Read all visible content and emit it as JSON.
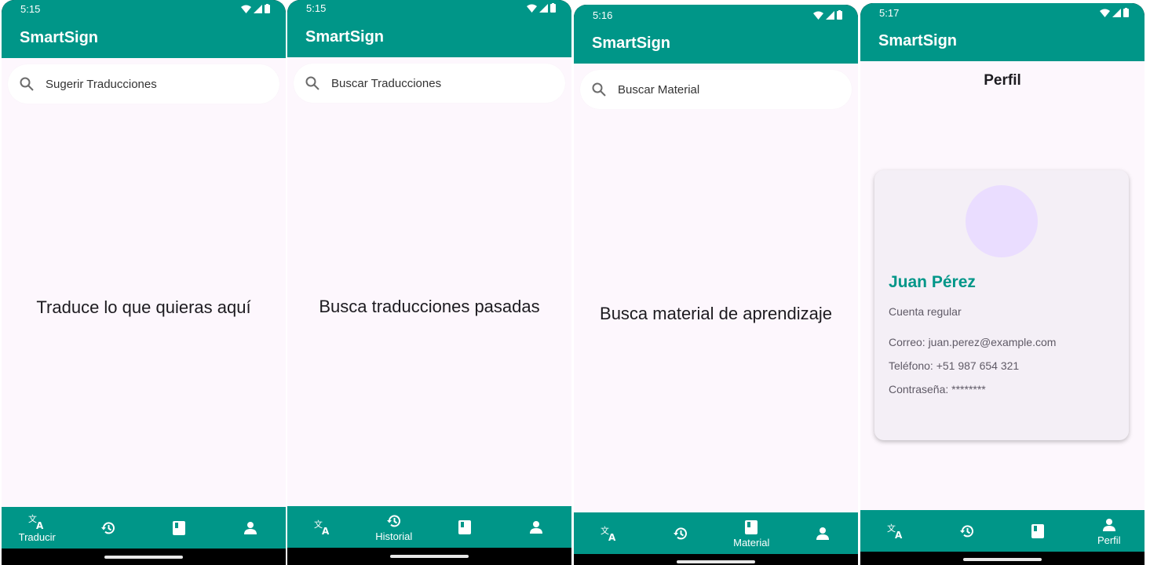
{
  "app_title": "SmartSign",
  "nav": {
    "translate_label": "Traducir",
    "history_label": "Historial",
    "material_label": "Material",
    "profile_label": "Perfil"
  },
  "screens": [
    {
      "time": "5:15",
      "search_placeholder": "Sugerir Traducciones",
      "body_text": "Traduce lo que quieras aquí",
      "active_tab": "translate"
    },
    {
      "time": "5:15",
      "search_placeholder": "Buscar Traducciones",
      "body_text": "Busca traducciones pasadas",
      "active_tab": "history"
    },
    {
      "time": "5:16",
      "search_placeholder": "Buscar Material",
      "body_text": "Busca material de aprendizaje",
      "active_tab": "material"
    },
    {
      "time": "5:17",
      "title": "Perfil",
      "active_tab": "profile",
      "profile": {
        "name": "Juan Pérez",
        "account_type": "Cuenta regular",
        "email": "Correo: juan.perez@example.com",
        "phone": "Teléfono: +51 987 654 321",
        "password": "Contraseña: ********"
      }
    }
  ],
  "colors": {
    "primary": "#009688",
    "background": "#fdf7fd",
    "avatar": "#eaddff"
  },
  "icons": [
    "search-icon",
    "translate-icon",
    "history-icon",
    "book-icon",
    "person-icon",
    "wifi-icon",
    "signal-icon",
    "battery-icon"
  ]
}
